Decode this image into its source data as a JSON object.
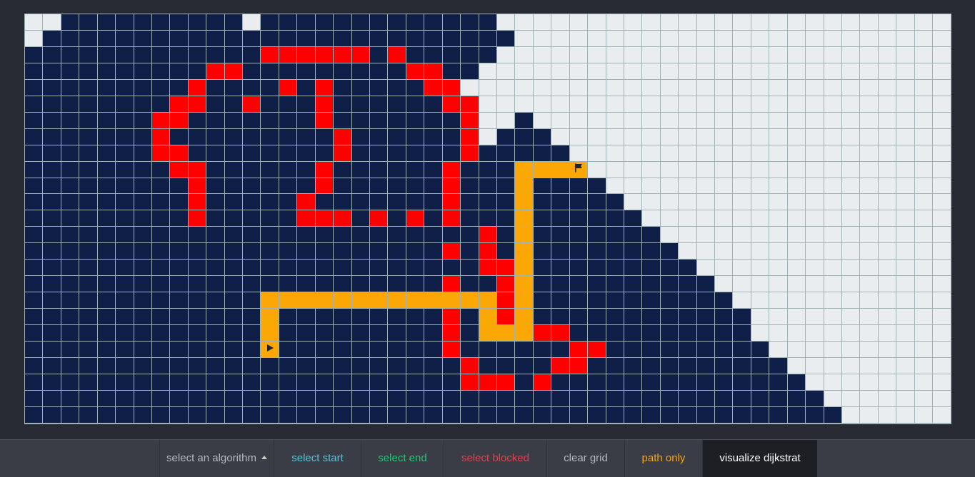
{
  "colors": {
    "unvisited": "#e9edef",
    "visited": "#0f1f47",
    "wall": "#fe0000",
    "path": "#fba806",
    "grid_line": "#9db3b6"
  },
  "grid": {
    "cols": 51,
    "rows": 25,
    "start_icon": "play-icon",
    "end_icon": "flag-icon",
    "cells": [
      "UUVVVVVVVVVVUVVVVVVVVVVVVVUUUUUUUUUUUUUUUUUUUUUUUUU",
      "UVVVVVVVVVVVVVVVVVVVVVVVVVVUUUUUUUUUUUUUUUUUUUUUUUU",
      "VVVVVVVVVVVVVWWWWWWVWVVVVVUUUUUUUUUUUUUUUUUUUUUUUUU",
      "VVVVVVVVVVWWVVVVVVVVVWWVVUUUUUUUUUUUUUUUUUUUUUUUUUU",
      "VVVVVVVVVWVVVVWVWVVVVVWWUUUUUUUUUUUUUUUUUUUUUUUUUUU",
      "VVVVVVVVWWVVWVVVWVVVVVVWWUUUUUUUUUUUUUUUUUUUUUUUUUU",
      "VVVVVVVWWVVVVVVVWVVVVVVVWUUVUUUUUUUUUUUUUUUUUUUUUUU",
      "VVVVVVVWVVVVVVVVVWVVVVVVWUVVVUUUUUUUUUUUUUUUUUUUUUU",
      "VVVVVVVWWVVVVVVVVWVVVVVVWVVVVVUUUUUUUUUUUUUUUUUUUUU",
      "VVVVVVVVWWVVVVVVWVVVVVVWVVVPPPEUUUUUUUUUUUUUUUUUUUU",
      "VVVVVVVVVWVVVVVVWVVVVVVWVVVPVVVVUUUUUUUUUUUUUUUUUUU",
      "VVVVVVVVVWVVVVVWVVVVVVVWVVVPVVVVVUUUUUUUUUUUUUUUUUU",
      "VVVVVVVVVWVVVVVWWWVWVWVWVVVPVVVVVVUUUUUUUUUUUUUUUUU",
      "VVVVVVVVVVVVVVVVVVVVVVVVVWVPVVVVVVVUUUUUUUUUUUUUUUU",
      "VVVVVVVVVVVVVVVVVVVVVVVWVWVPVVVVVVVVUUUUUUUUUUUUUUU",
      "VVVVVVVVVVVVVVVVVVVVVVVVVWWPVVVVVVVVVUUUUUUUUUUUUUU",
      "VVVVVVVVVVVVVVVVVVVVVVVWVVWPVVVVVVVVVVUUUUUUUUUUUUU",
      "VVVVVVVVVVVVVPPPPPPPPPPPPPWPVVVVVVVVVVVUUUUUUUUUUUU",
      "VVVVVVVVVVVVVPVVVVVVVVVWVPWPVVVVVVVVVVVVUUUUUUUUUUU",
      "VVVVVVVVVVVVVPVVVVVVVVVWVPPPWWVVVVVVVVVVUUUUUUUUUUU",
      "VVVVVVVVVVVVVSVVVVVVVVVWVVVVVVWWVVVVVVVVVUUUUUUUUUU",
      "VVVVVVVVVVVVVVVVVVVVVVVVWVVVVWWVVVVVVVVVVVUUUUUUUUU",
      "VVVVVVVVVVVVVVVVVVVVVVVVWWWVWVVVVVVVVVVVVVVUUUUUUUU",
      "VVVVVVVVVVVVVVVVVVVVVVVVVVVVVVVVVVVVVVVVVVVVUUUUUUU",
      "VVVVVVVVVVVVVVVVVVVVVVVVVVVVVVVVVVVVVVVVVVVVVUUUUUU"
    ]
  },
  "toolbar": {
    "algorithm_label": "select an algorithm",
    "select_start_label": "select start",
    "select_end_label": "select end",
    "select_blocked_label": "select blocked",
    "clear_grid_label": "clear grid",
    "path_only_label": "path only",
    "visualize_label": "visualize dijkstrat",
    "colors": {
      "algorithm": "#b5b7bc",
      "select_start": "#5bc0de",
      "select_end": "#2fbf71",
      "select_blocked": "#e2404a",
      "clear_grid": "#b5b7bc",
      "path_only": "#f7a41c",
      "visualize": "#ffffff"
    }
  }
}
